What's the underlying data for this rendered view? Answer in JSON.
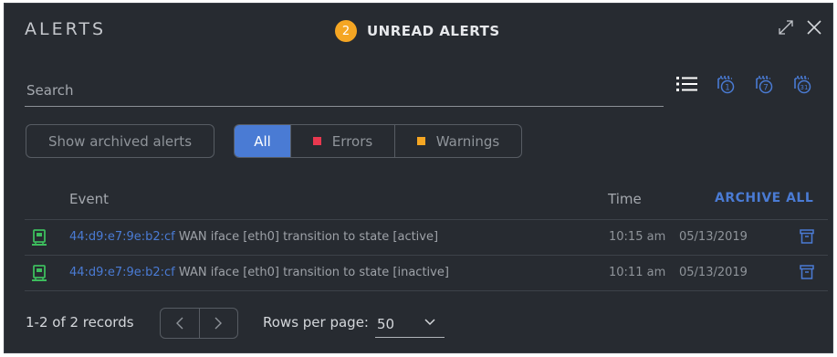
{
  "header": {
    "title": "ALERTS",
    "unread_count": "2",
    "unread_label": "UNREAD ALERTS"
  },
  "search": {
    "placeholder": "Search"
  },
  "filters": {
    "archived_button": "Show archived alerts",
    "segments": [
      "All",
      "Errors",
      "Warnings"
    ],
    "selected": "All",
    "colors": {
      "accent": "#4a7bd4",
      "errors": "#e8384f",
      "warnings": "#f5a623",
      "device": "#3dbd5d"
    }
  },
  "table": {
    "columns": {
      "event": "Event",
      "time": "Time"
    },
    "archive_all": "ARCHIVE ALL",
    "rows": [
      {
        "mac": "44:d9:e7:9e:b2:cf",
        "message": " WAN iface [eth0] transition to state [active]",
        "time": "10:15 am",
        "date": "05/13/2019"
      },
      {
        "mac": "44:d9:e7:9e:b2:cf",
        "message": " WAN iface [eth0] transition to state [inactive]",
        "time": "10:11 am",
        "date": "05/13/2019"
      }
    ]
  },
  "pagination": {
    "records": "1-2 of 2 records",
    "rows_per_page_label": "Rows per page:",
    "rows_per_page": "50"
  },
  "icons": {
    "expand": "expand-icon",
    "close": "close-icon",
    "list": "list-view-icon",
    "calendar_1": "calendar-1-day-icon",
    "calendar_7": "calendar-7-days-icon",
    "calendar_31": "calendar-31-days-icon",
    "device": "gateway-device-icon",
    "archive": "archive-icon"
  }
}
